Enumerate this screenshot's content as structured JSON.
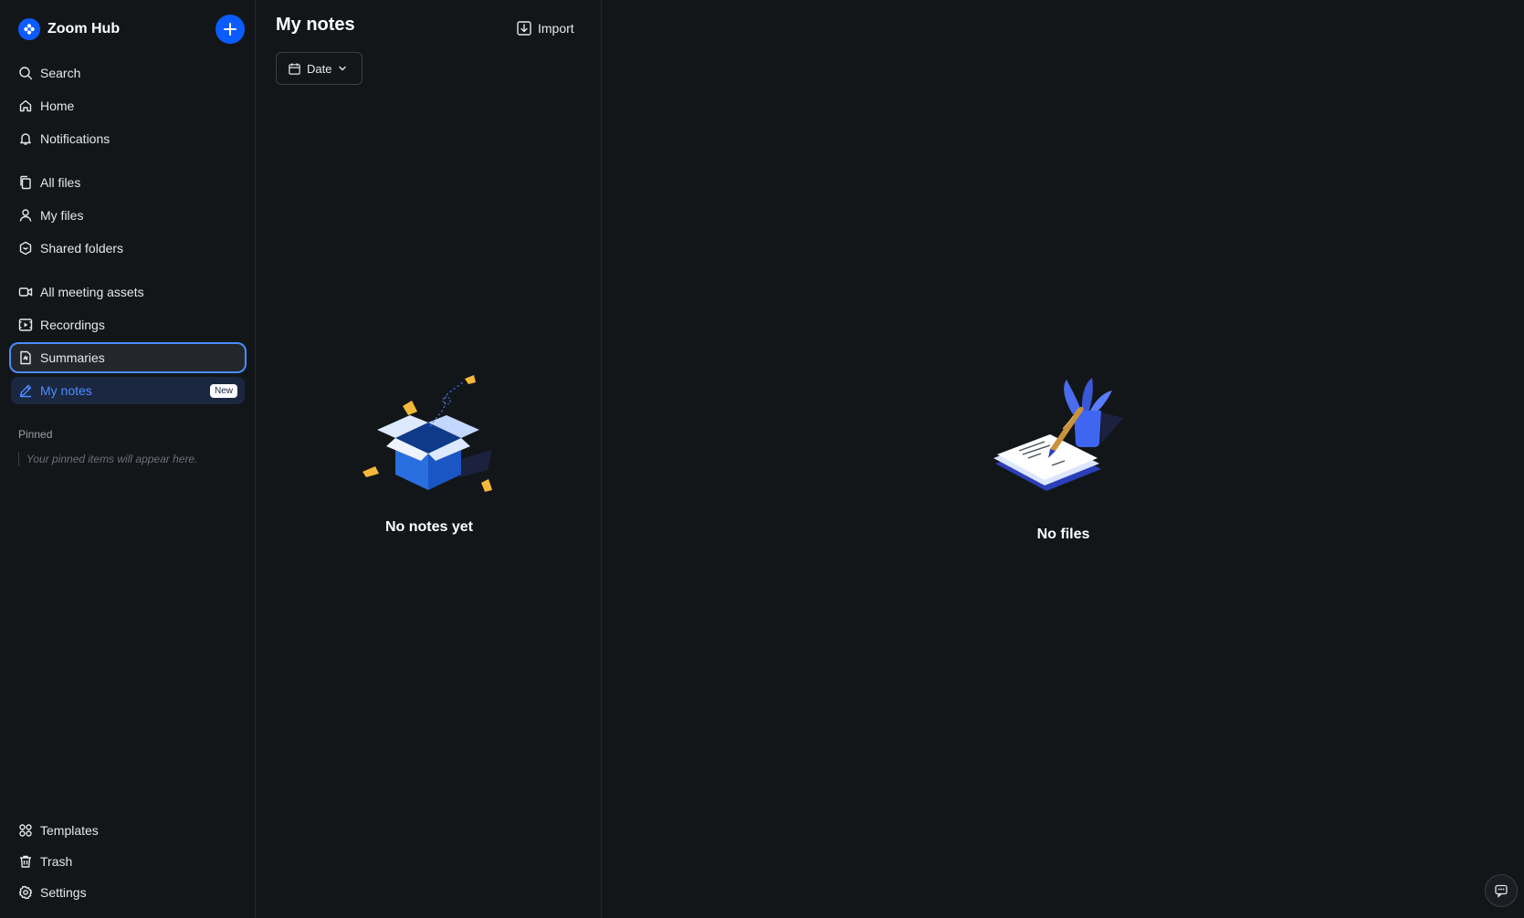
{
  "app": {
    "name": "Zoom Hub"
  },
  "sidebar": {
    "new_button_icon": "plus-icon",
    "top_items": [
      {
        "label": "Search",
        "icon": "search-icon"
      },
      {
        "label": "Home",
        "icon": "home-icon"
      },
      {
        "label": "Notifications",
        "icon": "bell-icon"
      }
    ],
    "file_items": [
      {
        "label": "All files",
        "icon": "files-icon"
      },
      {
        "label": "My files",
        "icon": "user-icon"
      },
      {
        "label": "Shared folders",
        "icon": "shared-folder-icon"
      }
    ],
    "meeting_items": [
      {
        "label": "All meeting assets",
        "icon": "video-icon"
      },
      {
        "label": "Recordings",
        "icon": "recording-icon"
      },
      {
        "label": "Summaries",
        "icon": "summary-icon",
        "state": "focused"
      },
      {
        "label": "My notes",
        "icon": "pencil-icon",
        "state": "active",
        "badge": "New"
      }
    ],
    "pinned": {
      "label": "Pinned",
      "hint": "Your pinned items will appear here."
    },
    "bottom_items": [
      {
        "label": "Templates",
        "icon": "templates-icon"
      },
      {
        "label": "Trash",
        "icon": "trash-icon"
      },
      {
        "label": "Settings",
        "icon": "gear-icon"
      }
    ]
  },
  "notes_panel": {
    "title": "My notes",
    "import_label": "Import",
    "filter_label": "Date",
    "empty_text": "No notes yet"
  },
  "files_panel": {
    "empty_text": "No files"
  },
  "colors": {
    "background": "#131619",
    "accent": "#0b5cff",
    "active_text": "#4a8dff",
    "active_bg": "#1b2740"
  }
}
